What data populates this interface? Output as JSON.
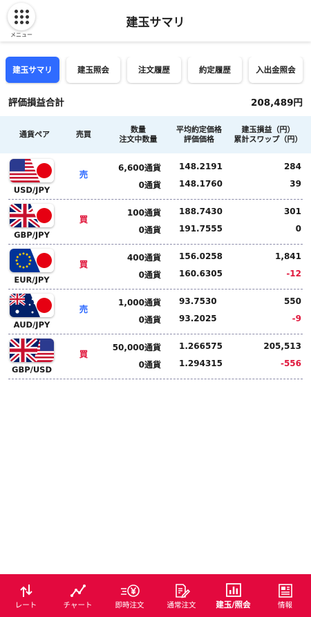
{
  "header": {
    "title": "建玉サマリ",
    "menu_label": "メニュー"
  },
  "tabs": [
    {
      "label": "建玉サマリ",
      "active": true
    },
    {
      "label": "建玉照会",
      "active": false
    },
    {
      "label": "注文履歴",
      "active": false
    },
    {
      "label": "約定履歴",
      "active": false
    },
    {
      "label": "入出金照会",
      "active": false
    }
  ],
  "summary": {
    "label": "評価損益合計",
    "value": "208,489円"
  },
  "columns": {
    "pair": "通貨ペア",
    "side": "売買",
    "qty_1": "数量",
    "qty_2": "注文中数量",
    "price_1": "平均約定価格",
    "price_2": "評価価格",
    "pl_1": "建玉損益（円）",
    "pl_2": "累計スワップ（円）"
  },
  "positions": [
    {
      "pair": "USD/JPY",
      "flag": "usd-jpy-flag-icon",
      "side": "売",
      "side_type": "sell",
      "qty": "6,600通貨",
      "pending_qty": "0通貨",
      "avg_price": "148.2191",
      "eval_price": "148.1760",
      "pl": "284",
      "swap": "39",
      "swap_negative": false
    },
    {
      "pair": "GBP/JPY",
      "flag": "gbp-jpy-flag-icon",
      "side": "買",
      "side_type": "buy",
      "qty": "100通貨",
      "pending_qty": "0通貨",
      "avg_price": "188.7430",
      "eval_price": "191.7555",
      "pl": "301",
      "swap": "0",
      "swap_negative": false
    },
    {
      "pair": "EUR/JPY",
      "flag": "eur-jpy-flag-icon",
      "side": "買",
      "side_type": "buy",
      "qty": "400通貨",
      "pending_qty": "0通貨",
      "avg_price": "156.0258",
      "eval_price": "160.6305",
      "pl": "1,841",
      "swap": "-12",
      "swap_negative": true
    },
    {
      "pair": "AUD/JPY",
      "flag": "aud-jpy-flag-icon",
      "side": "売",
      "side_type": "sell",
      "qty": "1,000通貨",
      "pending_qty": "0通貨",
      "avg_price": "93.7530",
      "eval_price": "93.2025",
      "pl": "550",
      "swap": "-9",
      "swap_negative": true
    },
    {
      "pair": "GBP/USD",
      "flag": "gbp-usd-flag-icon",
      "side": "買",
      "side_type": "buy",
      "qty": "50,000通貨",
      "pending_qty": "0通貨",
      "avg_price": "1.266575",
      "eval_price": "1.294315",
      "pl": "205,513",
      "swap": "-556",
      "swap_negative": true
    }
  ],
  "nav": [
    {
      "label": "レート",
      "icon": "rate-arrows-icon",
      "active": false
    },
    {
      "label": "チャート",
      "icon": "chart-line-icon",
      "active": false
    },
    {
      "label": "即時注文",
      "icon": "instant-order-yen-icon",
      "active": false
    },
    {
      "label": "通常注文",
      "icon": "order-document-pen-icon",
      "active": false
    },
    {
      "label": "建玉/照会",
      "icon": "position-bars-icon",
      "active": true
    },
    {
      "label": "情報",
      "icon": "news-icon",
      "active": false
    }
  ],
  "colors": {
    "accent_blue": "#2f6bff",
    "brand_red": "#e3093e",
    "negative_red": "#e0173c",
    "header_bg": "#e9f4fb"
  }
}
